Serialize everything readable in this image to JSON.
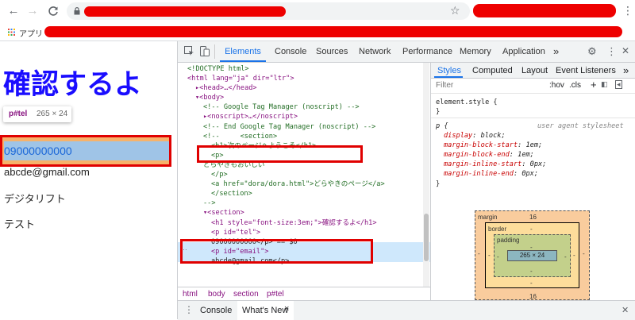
{
  "browser": {
    "bookmarks_apps_label": "アプリ"
  },
  "page": {
    "heading": "確認するよ",
    "tel": "09000000000",
    "email": "abcde@gmail.com",
    "line3": "デジタリフト",
    "line4": "テスト",
    "tooltip_selector": "p#tel",
    "tooltip_size": "265 × 24"
  },
  "devtools": {
    "tabs": [
      "Elements",
      "Console",
      "Sources",
      "Network",
      "Performance",
      "Memory",
      "Application"
    ],
    "more": "»",
    "code_lines": [
      {
        "indent": 0,
        "html": "<!DOCTYPE html>",
        "cls": "c-cm"
      },
      {
        "indent": 0,
        "html": "<html lang=\"ja\" dir=\"ltr\">"
      },
      {
        "indent": 1,
        "html": "▸<head>…</head>"
      },
      {
        "indent": 1,
        "html": "▾<body>"
      },
      {
        "indent": 2,
        "html": "<!-- Google Tag Manager (noscript) -->",
        "cls": "c-cm"
      },
      {
        "indent": 2,
        "html": "▸<noscript>…</noscript>"
      },
      {
        "indent": 2,
        "html": "<!-- End Google Tag Manager (noscript) -->",
        "cls": "c-cm"
      },
      {
        "indent": 2,
        "html": "<!--     <section>",
        "cls": "c-cm"
      },
      {
        "indent": 3,
        "html": "<h1>次のページへようこそ</h1>",
        "cls": "c-cm"
      },
      {
        "indent": 3,
        "html": "<p>",
        "cls": "c-cm"
      },
      {
        "indent": 2,
        "html": "どらやきもおいしい",
        "cls": "c-cm"
      },
      {
        "indent": 3,
        "html": "</p>",
        "cls": "c-cm"
      },
      {
        "indent": 3,
        "html": "<a href=\"dora/dora.html\">どらやきのページ</a>",
        "cls": "c-cm"
      },
      {
        "indent": 3,
        "html": "</section>",
        "cls": "c-cm"
      },
      {
        "indent": 2,
        "html": "-->",
        "cls": "c-cm"
      },
      {
        "indent": 2,
        "html": "▾<section>"
      },
      {
        "indent": 3,
        "html": "<h1 style=\"font-size:3em;\">確認するよ</h1>"
      },
      {
        "indent": 3,
        "html": "<p id=\"tel\">"
      },
      {
        "indent": 3,
        "html": "09000000000</p> == $0",
        "cls": "c-txt"
      },
      {
        "indent": 3,
        "html": "<p id=\"email\">"
      },
      {
        "indent": 3,
        "html": "abcde@gmail.com</p>",
        "cls": "c-txt"
      }
    ],
    "breadcrumbs": [
      "html",
      "body",
      "section",
      "p#tel"
    ],
    "styles_tabs": [
      "Styles",
      "Computed",
      "Layout",
      "Event Listeners",
      "»"
    ],
    "filter_placeholder": "Filter",
    "hov": ":hov",
    "cls": ".cls",
    "element_style": "element.style {",
    "close_brace": "}",
    "p_selector": "p {",
    "ua_label": "user agent stylesheet",
    "rules": [
      {
        "prop": "display",
        "val": "block;"
      },
      {
        "prop": "margin-block-start",
        "val": "1em;"
      },
      {
        "prop": "margin-block-end",
        "val": "1em;"
      },
      {
        "prop": "margin-inline-start",
        "val": "0px;"
      },
      {
        "prop": "margin-inline-end",
        "val": "0px;"
      }
    ],
    "box": {
      "margin_label": "margin",
      "margin_top": "16",
      "margin_bottom": "16",
      "margin_side": "-",
      "border_label": "border",
      "border_val": "-",
      "padding_label": "padding",
      "padding_val": "-",
      "content": "265 × 24"
    },
    "drawer_tabs": [
      "Console",
      "What's New"
    ],
    "drawer_close": "×"
  }
}
